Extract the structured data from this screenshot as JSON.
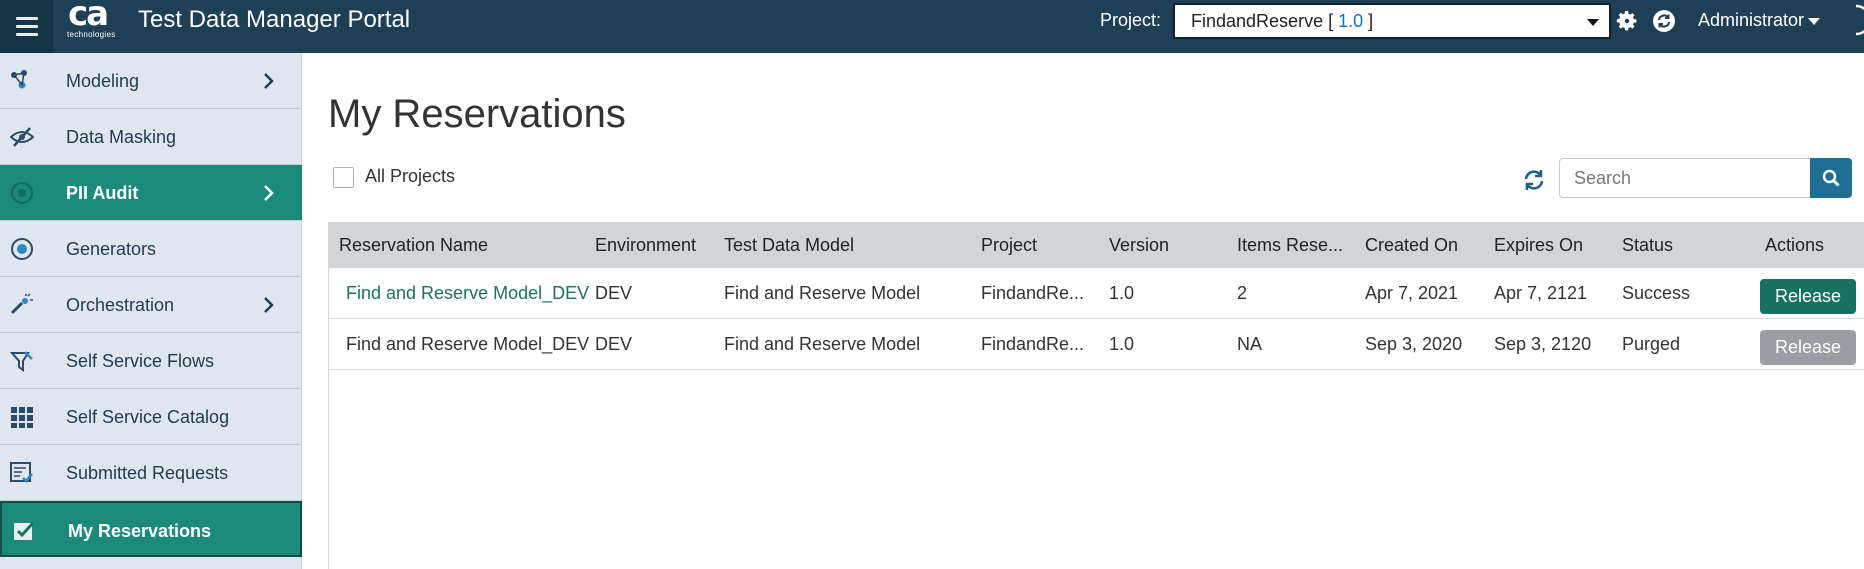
{
  "header": {
    "logo_text": "ca",
    "logo_subtext": "technologies",
    "app_title": "Test Data Manager Portal",
    "project_label": "Project:",
    "project_name": "FindandReserve [",
    "project_version": "1.0",
    "project_close": "]",
    "user": "Administrator"
  },
  "sidebar": {
    "items": [
      {
        "label": "Modeling",
        "icon": "modeling-icon",
        "has_submenu": true
      },
      {
        "label": "Data Masking",
        "icon": "data-masking-icon",
        "has_submenu": false
      },
      {
        "label": "PII Audit",
        "icon": "pii-audit-icon",
        "has_submenu": true
      },
      {
        "label": "Generators",
        "icon": "generators-icon",
        "has_submenu": false
      },
      {
        "label": "Orchestration",
        "icon": "orchestration-icon",
        "has_submenu": true
      },
      {
        "label": "Self Service Flows",
        "icon": "self-service-flows-icon",
        "has_submenu": false
      },
      {
        "label": "Self Service Catalog",
        "icon": "grid-icon",
        "has_submenu": false
      },
      {
        "label": "Submitted Requests",
        "icon": "submitted-requests-icon",
        "has_submenu": false
      },
      {
        "label": "My Reservations",
        "icon": "reservations-check-icon",
        "has_submenu": false
      }
    ]
  },
  "main": {
    "title": "My Reservations",
    "all_projects_label": "All Projects",
    "search_placeholder": "Search",
    "columns": [
      "Reservation Name",
      "Environment",
      "Test Data Model",
      "Project",
      "Version",
      "Items Rese...",
      "Created On",
      "Expires On",
      "Status",
      "Actions"
    ],
    "rows": [
      {
        "name": "Find and Reserve Model_DEV_",
        "environment": "DEV",
        "model": "Find and Reserve Model",
        "project": "FindandRe...",
        "version": "1.0",
        "items": "2",
        "created": "Apr 7, 2021",
        "expires": "Apr 7, 2121",
        "status": "Success",
        "action": "Release"
      },
      {
        "name": "Find and Reserve Model_DEV",
        "environment": "DEV",
        "model": "Find and Reserve Model",
        "project": "FindandRe...",
        "version": "1.0",
        "items": "NA",
        "created": "Sep 3, 2020",
        "expires": "Sep 3, 2120",
        "status": "Purged",
        "action": "Release"
      }
    ]
  },
  "colors": {
    "header_bg": "#1e3f54",
    "sidebar_bg": "#dfe6ee",
    "active_item": "#1b8a7b",
    "link": "#1f6f63",
    "release_enabled": "#17735f",
    "release_disabled": "#9a9ea3",
    "search_button": "#1f6e96"
  }
}
